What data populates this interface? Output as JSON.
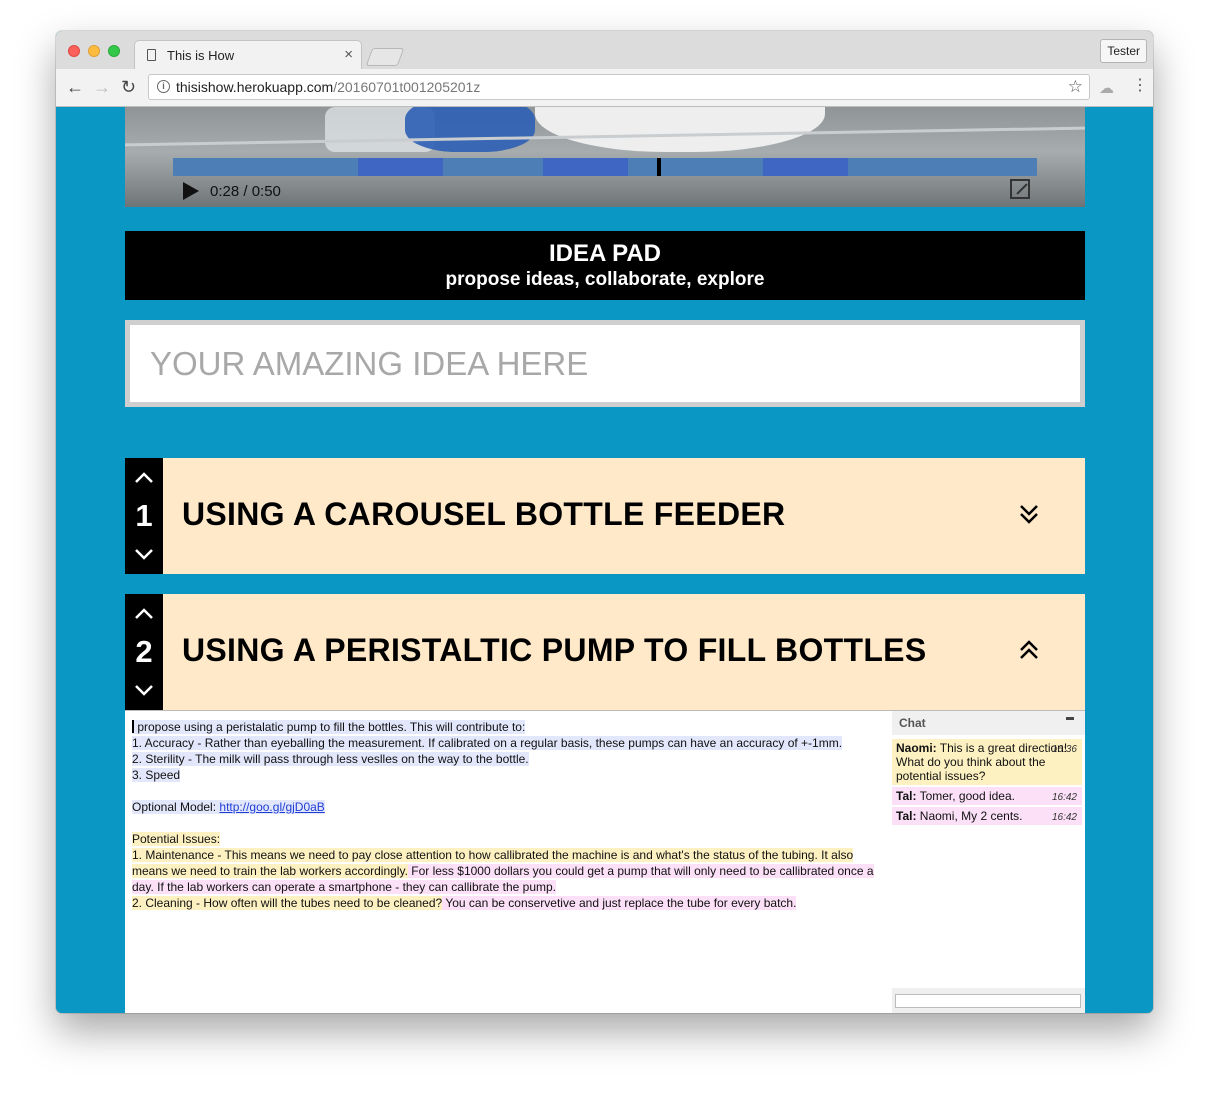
{
  "browser": {
    "tab_title": "This is How",
    "tab_close": "×",
    "profile_label": "Tester",
    "url_host": "thisishow.herokuapp.com",
    "url_path": "/20160701t001205201z"
  },
  "video": {
    "timecode": "0:28 / 0:50",
    "progress_fraction": 0.56
  },
  "banner": {
    "title": "IDEA PAD",
    "subtitle": "propose ideas, collaborate, explore"
  },
  "idea_input": {
    "placeholder": "YOUR AMAZING IDEA HERE"
  },
  "ideas": [
    {
      "number": "1",
      "title": "USING A CAROUSEL BOTTLE FEEDER",
      "expanded": false
    },
    {
      "number": "2",
      "title": "USING A PERISTALTIC PUMP TO FILL BOTTLES",
      "expanded": true
    }
  ],
  "idea_detail": {
    "intro": " propose using a peristalatic pump to fill the bottles. This will contribute to:",
    "benefit_1": "1. Accuracy - Rather than eyeballing the measurement. If calibrated on a regular basis, these pumps can have an accuracy of +-1mm.",
    "benefit_2": "2. Sterility - The milk will pass through less veslles on the way to the bottle.",
    "benefit_3": "3. Speed",
    "model_label": "Optional Model: ",
    "model_link": "http://goo.gl/gjD0aB",
    "issues_heading": "Potential Issues:",
    "issue_1_a": "1. Maintenance  - This means we need to pay close attention to how callibrated the machine is and what's the status of the tubing. It also",
    "issue_1_b": "means we need to train the lab workers accordingly.",
    "issue_1_comment_a": " For less $1000 dollars you could get a pump that will only need to be callibrated once a",
    "issue_1_comment_b": "day. If the lab workers can operate a smartphone - they can callibrate the pump.",
    "issue_2": "2. Cleaning - How often will the tubes need to be cleaned?",
    "issue_2_comment": " You can be conservetive and just replace the tube for every batch."
  },
  "chat": {
    "title": "Chat",
    "messages": [
      {
        "author": "Naomi:",
        "text": " This is a great direction! What do you think about the potential issues?",
        "time": "16:36"
      },
      {
        "author": "Tal:",
        "text": " Tomer, good idea.",
        "time": "16:42"
      },
      {
        "author": "Tal:",
        "text": " Naomi, My 2 cents.",
        "time": "16:42"
      }
    ]
  },
  "colors": {
    "page_background": "#0b97c4",
    "idea_header": "#ffe9c9",
    "highlight_blue": "#e3e7fb",
    "highlight_yellow": "#fdf1c2",
    "highlight_pink": "#fbe0f7"
  },
  "icons": {
    "vote_up": "chevron-up-icon",
    "vote_down": "chevron-down-icon",
    "expand": "double-chevron-down-icon",
    "collapse": "double-chevron-up-icon",
    "play": "play-icon",
    "fullscreen": "fullscreen-icon"
  }
}
